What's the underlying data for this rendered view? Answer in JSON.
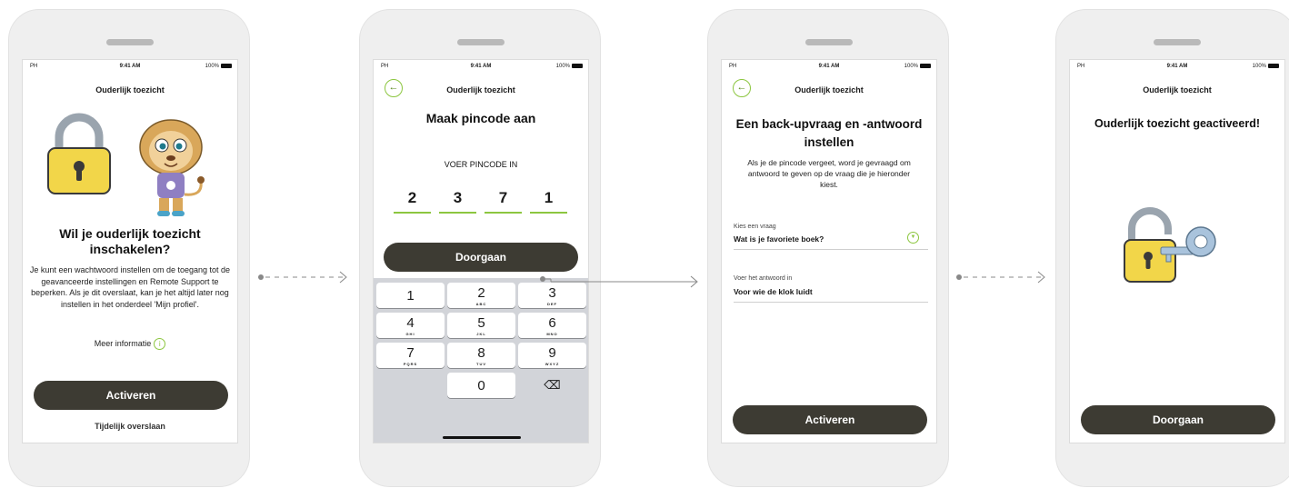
{
  "status_bar": {
    "carrier": "PH",
    "time": "9:41 AM",
    "battery": "100%"
  },
  "screen1": {
    "nav_title": "Ouderlijk toezicht",
    "heading": "Wil je ouderlijk toezicht inschakelen?",
    "body": "Je kunt een wachtwoord instellen om de toegang tot de geavanceerde instellingen en Remote Support te beperken. Als je dit overslaat, kan je het altijd later nog instellen in het onderdeel 'Mijn profiel'.",
    "more_info": "Meer informatie",
    "primary_button": "Activeren",
    "skip_link": "Tijdelijk overslaan"
  },
  "screen2": {
    "nav_title": "Ouderlijk toezicht",
    "heading": "Maak pincode aan",
    "pin_label": "VOER PINCODE IN",
    "pin_digits": [
      "2",
      "3",
      "7",
      "1"
    ],
    "continue_button": "Doorgaan",
    "keypad": [
      {
        "num": "1",
        "letters": ""
      },
      {
        "num": "2",
        "letters": "ABC"
      },
      {
        "num": "3",
        "letters": "DEF"
      },
      {
        "num": "4",
        "letters": "GHI"
      },
      {
        "num": "5",
        "letters": "JKL"
      },
      {
        "num": "6",
        "letters": "MNO"
      },
      {
        "num": "7",
        "letters": "PQRS"
      },
      {
        "num": "8",
        "letters": "TUV"
      },
      {
        "num": "9",
        "letters": "WXYZ"
      },
      {
        "num": "0",
        "letters": ""
      }
    ],
    "delete_icon": "⌫"
  },
  "screen3": {
    "nav_title": "Ouderlijk toezicht",
    "heading_line1": "Een back-upvraag en -antwoord",
    "heading_line2": "instellen",
    "body": "Als je de pincode vergeet, word je gevraagd om antwoord te geven op de vraag die je hieronder kiest.",
    "question_label": "Kies een vraag",
    "question_value": "Wat is je favoriete boek?",
    "answer_label": "Voer het antwoord in",
    "answer_value": "Voor wie de klok luidt",
    "primary_button": "Activeren"
  },
  "screen4": {
    "nav_title": "Ouderlijk toezicht",
    "heading": "Ouderlijk toezicht geactiveerd!",
    "continue_button": "Doorgaan"
  },
  "colors": {
    "accent": "#8cc63f",
    "button": "#3d3b33",
    "lock": "#f2d649",
    "shackle": "#9aa4ae"
  },
  "icons": [
    "back-arrow-icon",
    "info-icon",
    "dropdown-chevron-icon",
    "delete-key-icon",
    "padlock-icon",
    "key-icon",
    "lion-mascot-icon"
  ]
}
